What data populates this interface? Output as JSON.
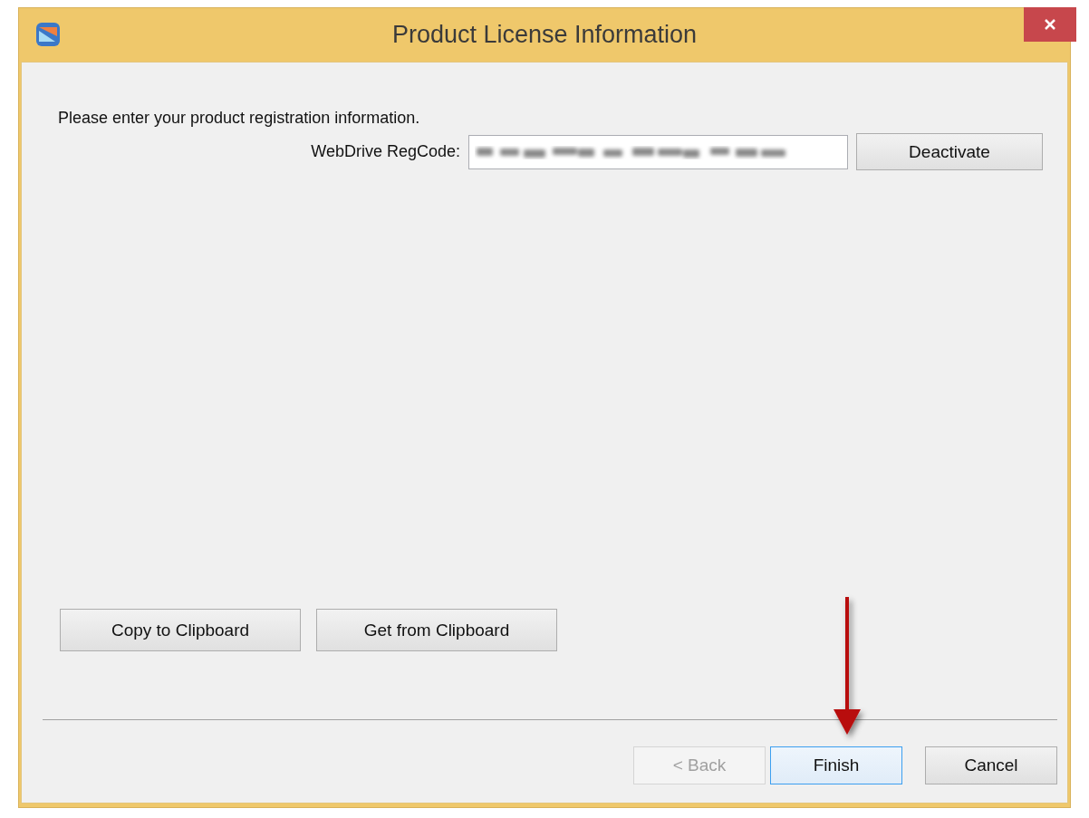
{
  "window": {
    "title": "Product License Information"
  },
  "instruction": "Please enter your product registration information.",
  "regcode": {
    "label": "WebDrive RegCode:",
    "button": "Deactivate"
  },
  "clipboard_buttons": [
    {
      "label": "Copy to Clipboard"
    },
    {
      "label": "Get from Clipboard"
    }
  ],
  "nav_buttons": [
    {
      "label": "< Back",
      "disabled": true,
      "focused": false
    },
    {
      "label": "Finish",
      "disabled": false,
      "focused": true
    },
    {
      "label": "Cancel",
      "disabled": false,
      "focused": false
    }
  ]
}
